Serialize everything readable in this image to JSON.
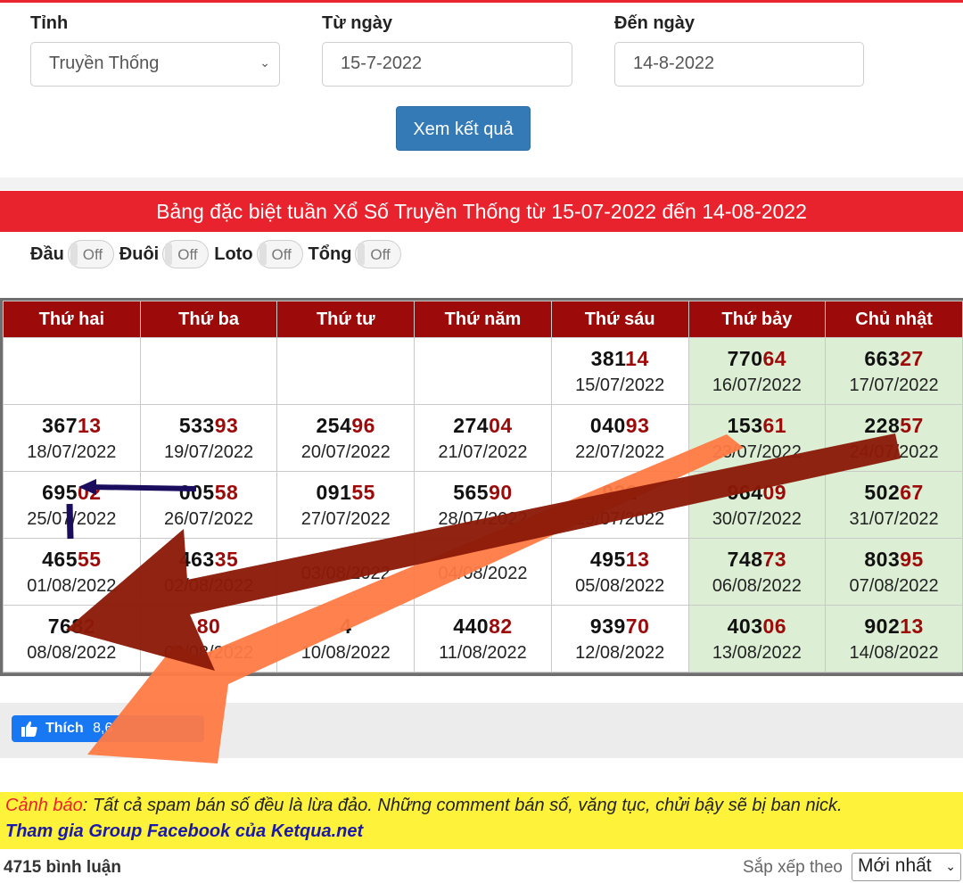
{
  "form": {
    "province_label": "Tỉnh",
    "province_value": "Truyền Thống",
    "from_label": "Từ ngày",
    "from_value": "15-7-2022",
    "to_label": "Đến ngày",
    "to_value": "14-8-2022",
    "submit_label": "Xem kết quả"
  },
  "banner": "Bảng đặc biệt tuần Xổ Số Truyền Thống từ 15-07-2022 đến 14-08-2022",
  "toggles": [
    {
      "label": "Đầu",
      "state": "Off"
    },
    {
      "label": "Đuôi",
      "state": "Off"
    },
    {
      "label": "Loto",
      "state": "Off"
    },
    {
      "label": "Tổng",
      "state": "Off"
    }
  ],
  "table": {
    "headers": [
      "Thứ hai",
      "Thứ ba",
      "Thứ tư",
      "Thứ năm",
      "Thứ sáu",
      "Thứ bảy",
      "Chủ nhật"
    ],
    "rows": [
      [
        null,
        null,
        null,
        null,
        {
          "head": "381",
          "tail": "14",
          "date": "15/07/2022"
        },
        {
          "head": "770",
          "tail": "64",
          "date": "16/07/2022"
        },
        {
          "head": "663",
          "tail": "27",
          "date": "17/07/2022"
        }
      ],
      [
        {
          "head": "367",
          "tail": "13",
          "date": "18/07/2022"
        },
        {
          "head": "533",
          "tail": "93",
          "date": "19/07/2022"
        },
        {
          "head": "254",
          "tail": "96",
          "date": "20/07/2022"
        },
        {
          "head": "274",
          "tail": "04",
          "date": "21/07/2022"
        },
        {
          "head": "040",
          "tail": "93",
          "date": "22/07/2022"
        },
        {
          "head": "153",
          "tail": "61",
          "date": "23/07/2022"
        },
        {
          "head": "228",
          "tail": "57",
          "date": "24/07/2022"
        }
      ],
      [
        {
          "head": "695",
          "tail": "02",
          "date": "25/07/2022"
        },
        {
          "head": "005",
          "tail": "58",
          "date": "26/07/2022"
        },
        {
          "head": "091",
          "tail": "55",
          "date": "27/07/2022"
        },
        {
          "head": "565",
          "tail": "90",
          "date": "28/07/2022"
        },
        {
          "head": "922",
          "tail": "",
          "date": "29/07/2022"
        },
        {
          "head": "964",
          "tail": "09",
          "date": "30/07/2022"
        },
        {
          "head": "502",
          "tail": "67",
          "date": "31/07/2022"
        }
      ],
      [
        {
          "head": "465",
          "tail": "55",
          "date": "01/08/2022"
        },
        {
          "head": "463",
          "tail": "35",
          "date": "02/08/2022"
        },
        {
          "head": "",
          "tail": "",
          "date": "03/08/2022"
        },
        {
          "head": "",
          "tail": "",
          "date": "04/08/2022"
        },
        {
          "head": "495",
          "tail": "13",
          "date": "05/08/2022"
        },
        {
          "head": "748",
          "tail": "73",
          "date": "06/08/2022"
        },
        {
          "head": "803",
          "tail": "95",
          "date": "07/08/2022"
        }
      ],
      [
        {
          "head": "768",
          "tail": "2",
          "date": "08/08/2022"
        },
        {
          "head": "",
          "tail": "80",
          "date": "09/08/2022"
        },
        {
          "head": "4",
          "tail": "",
          "date": "10/08/2022"
        },
        {
          "head": "440",
          "tail": "82",
          "date": "11/08/2022"
        },
        {
          "head": "939",
          "tail": "70",
          "date": "12/08/2022"
        },
        {
          "head": "403",
          "tail": "06",
          "date": "13/08/2022"
        },
        {
          "head": "902",
          "tail": "13",
          "date": "14/08/2022"
        }
      ]
    ]
  },
  "like": {
    "label": "Thích",
    "count": "8,6"
  },
  "warning": {
    "prefix": "Cảnh báo",
    "text": ": Tất cả spam bán số đều là lừa đảo. Những comment bán số, văng tục, chửi bậy sẽ bị ban nick.",
    "link": "Tham gia Group Facebook của Ketqua.net"
  },
  "comments": {
    "count_label": "4715 bình luận",
    "sort_label": "Sắp xếp theo",
    "sort_value": "Mới nhất"
  },
  "colors": {
    "brand_red": "#e8232e",
    "header_red": "#9c0a0a",
    "weekend_green": "#dcefd5",
    "button_blue": "#337ab7",
    "warning_yellow": "#fff23b"
  },
  "icons": [
    "chevron-down-icon",
    "thumbs-up-icon"
  ]
}
